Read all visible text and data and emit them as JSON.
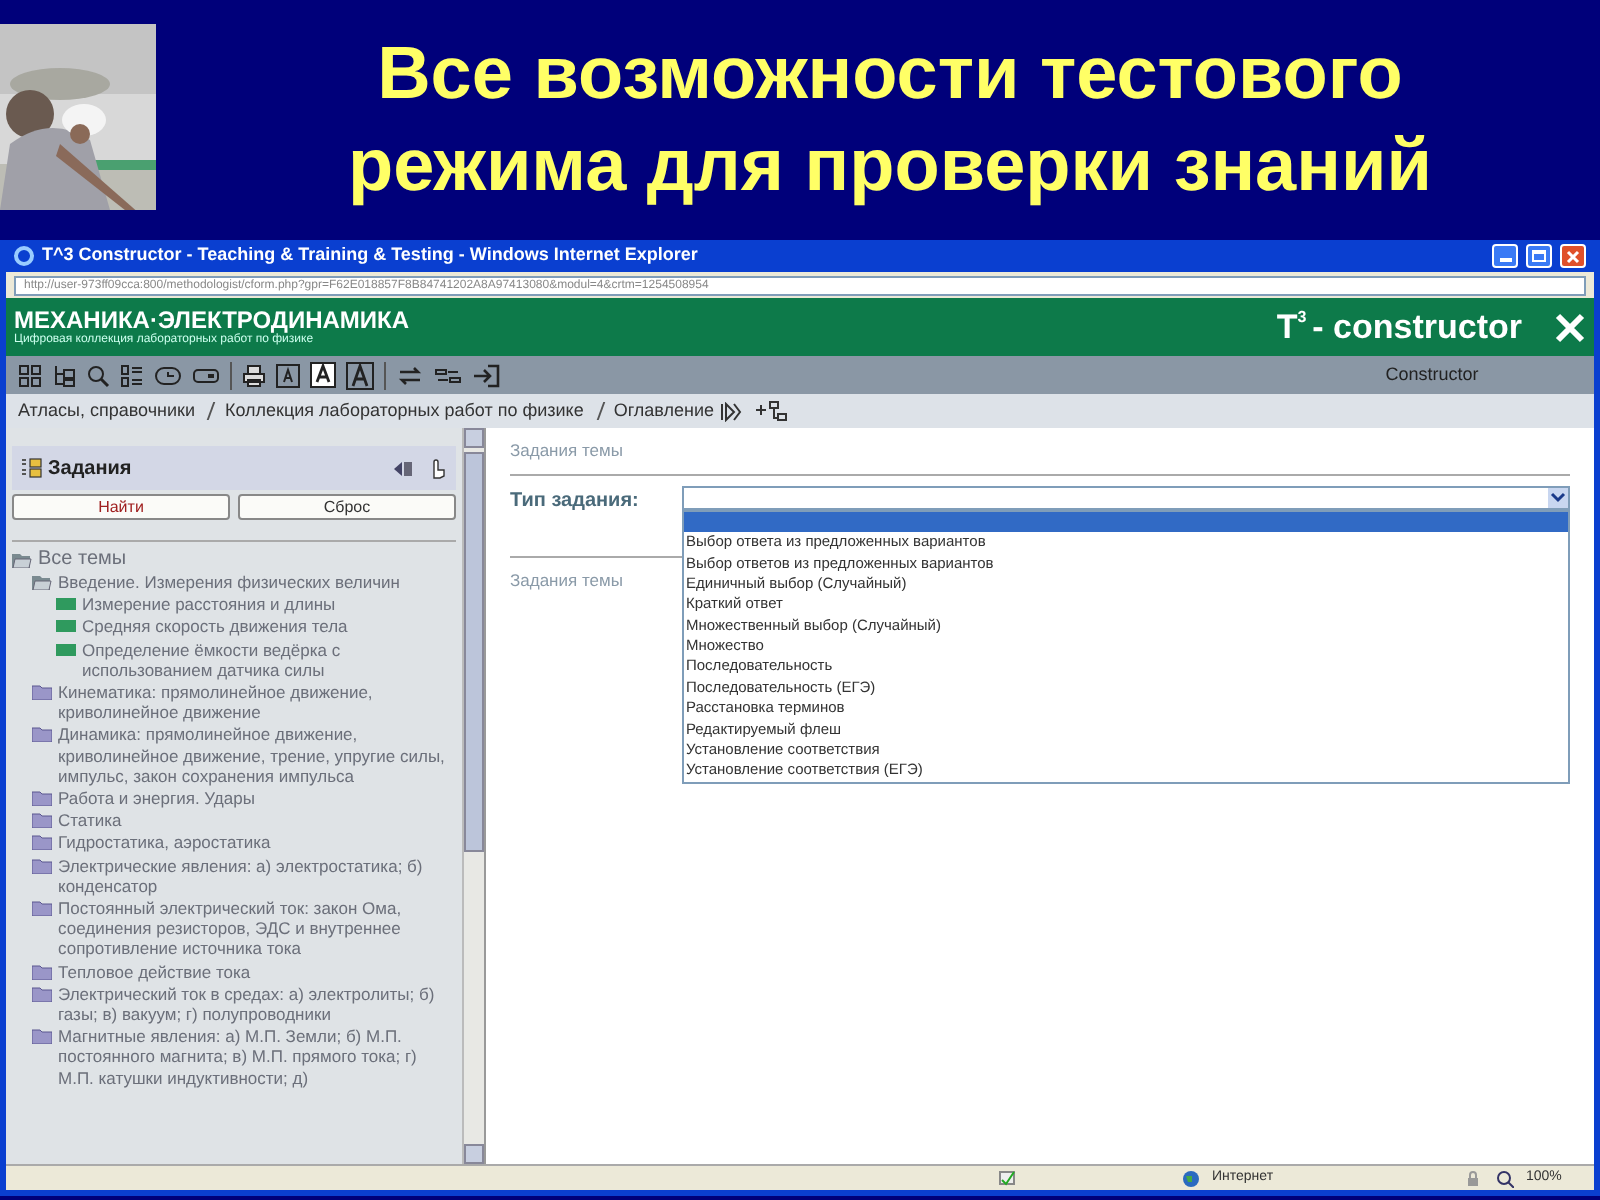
{
  "slide": {
    "title": "Все возможности тестового режима для проверки знаний"
  },
  "window": {
    "title": "T^3 Constructor - Teaching & Training & Testing - Windows Internet Explorer",
    "address": "http://user-973ff09cca:800/methodologist/cform.php?gpr=F62E018857F8B84741202A8A97413080&modul=4&crtm=1254508954"
  },
  "banner": {
    "title": "МЕХАНИКА·ЭЛЕКТРОДИНАМИКА",
    "subtitle": "Цифровая коллекция лабораторных работ по физике",
    "logo": "T",
    "logo_sup": "3",
    "logo_text": "- constructor",
    "section": "Constructor"
  },
  "breadcrumb": [
    "Атласы, справочники",
    "Коллекция лабораторных работ по физике",
    "Оглавление"
  ],
  "tasks_panel": {
    "title": "Задания",
    "buttons": [
      "Найти",
      "Сброс"
    ],
    "tree": [
      {
        "label": "Все темы",
        "expanded": true,
        "children": [
          {
            "label": "Введение. Измерения физических величин",
            "expanded": true,
            "children": [
              {
                "label": "Измерение расстояния и длины",
                "kind": "task"
              },
              {
                "label": "Средняя скорость движения тела",
                "kind": "task"
              },
              {
                "label": "Определение ёмкости ведёрка с использованием датчика силы",
                "kind": "task"
              }
            ]
          },
          {
            "label": "Кинематика: прямолинейное движение, криволинейное движение",
            "expanded": false
          },
          {
            "label": "Динамика: прямолинейное движение, криволинейное движение, трение, упругие силы, импульс, закон сохранения импульса",
            "expanded": false
          },
          {
            "label": "Работа и энергия. Удары",
            "expanded": false
          },
          {
            "label": "Статика",
            "expanded": false
          },
          {
            "label": "Гидростатика, аэростатика",
            "expanded": false
          },
          {
            "label": "Электрические явления: а) электростатика; б) конденсатор",
            "expanded": false
          },
          {
            "label": "Постоянный электрический ток: закон Ома, соединения резисторов, ЭДС и внутреннее сопротивление источника тока",
            "expanded": false
          },
          {
            "label": "Тепловое действие тока",
            "expanded": false
          },
          {
            "label": "Электрический ток в средах: а) электролиты; б) газы; в) вакуум; г) полупроводники",
            "expanded": false
          },
          {
            "label": "Магнитные явления: а) М.П. Земли; б) М.П. постоянного магнита; в) М.П. прямого тока; г) М.П. катушки индуктивности; д)",
            "expanded": false
          }
        ]
      }
    ]
  },
  "main": {
    "heading": "Задания темы",
    "field_label": "Тип задания:",
    "options": [
      {
        "selected": true
      },
      {
        "label": "Выбор ответа из предложенных вариантов",
        "selected": false
      },
      {
        "label": "Выбор ответов из предложенных вариантов",
        "selected": false
      },
      {
        "label": "Единичный выбор (Случайный)",
        "selected": false
      },
      {
        "label": "Краткий ответ",
        "selected": false
      },
      {
        "label": "Множественный выбор (Случайный)",
        "selected": false
      },
      {
        "label": "Множество",
        "selected": false
      },
      {
        "label": "Последовательность",
        "selected": false
      },
      {
        "label": "Последовательность (ЕГЭ)",
        "selected": false
      },
      {
        "label": "Расстановка терминов",
        "selected": false
      },
      {
        "label": "Редактируемый флеш",
        "selected": false
      },
      {
        "label": "Установление соответствия",
        "selected": false
      },
      {
        "label": "Установление соответствия (ЕГЭ)",
        "selected": false
      }
    ],
    "heading2": "Задания темы"
  },
  "status_bar": {
    "zone": "Интернет",
    "zoom": "100%"
  }
}
